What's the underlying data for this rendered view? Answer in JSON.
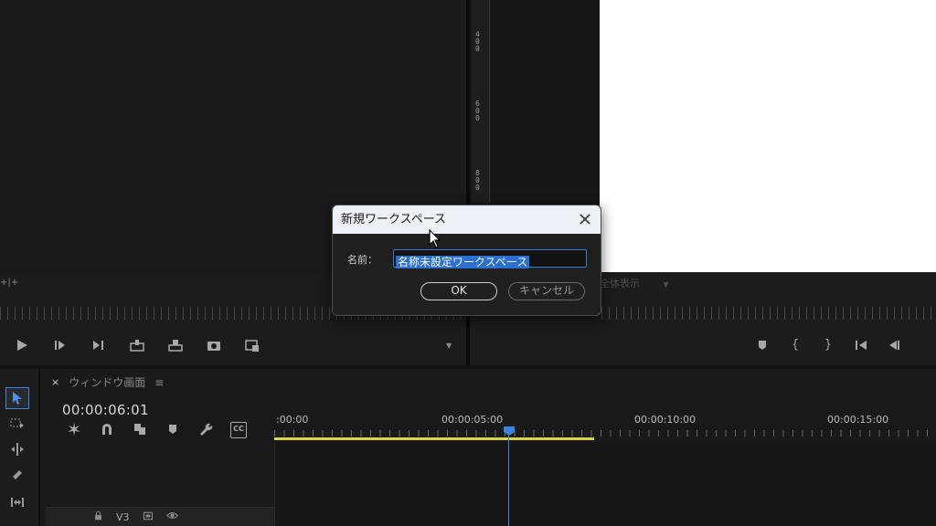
{
  "source_monitor": {
    "collapse_glyph": "+|+"
  },
  "program_monitor": {
    "ruler_labels": [
      "400",
      "600",
      "800"
    ],
    "fit_value": "全体表示"
  },
  "timeline": {
    "close_glyph": "×",
    "sequence_name": "ウィンドウ画面",
    "menu_glyph": "≡",
    "timecode": "00:00:06:01",
    "ruler_labels": [
      ":00:00",
      "00:00:05:00",
      "00:00:10:00",
      "00:00:15:00"
    ],
    "track_v3_label": "V3",
    "cc_label": "CC"
  },
  "dialog": {
    "title": "新規ワークスペース",
    "name_label": "名前：",
    "name_value": "名称未設定ワークスペース",
    "ok_label": "OK",
    "cancel_label": "キャンセル"
  },
  "colors": {
    "playhead": "#3b84e3",
    "work_area": "#d9d646",
    "selection": "#2b6fd0"
  },
  "icons": [
    "play-icon",
    "step-forward-icon",
    "go-to-out-icon",
    "insert-icon",
    "overwrite-icon",
    "camera-icon",
    "button-editor-icon",
    "marker-icon",
    "in-point-icon",
    "out-point-icon",
    "go-to-in-icon",
    "step-back-icon",
    "selection-tool-icon",
    "track-select-icon",
    "ripple-edit-icon",
    "razor-icon",
    "slip-icon",
    "snap-icon",
    "linked-selection-icon",
    "add-marker-icon",
    "wrench-icon",
    "lock-icon",
    "eye-icon",
    "close-icon",
    "cursor-icon"
  ]
}
